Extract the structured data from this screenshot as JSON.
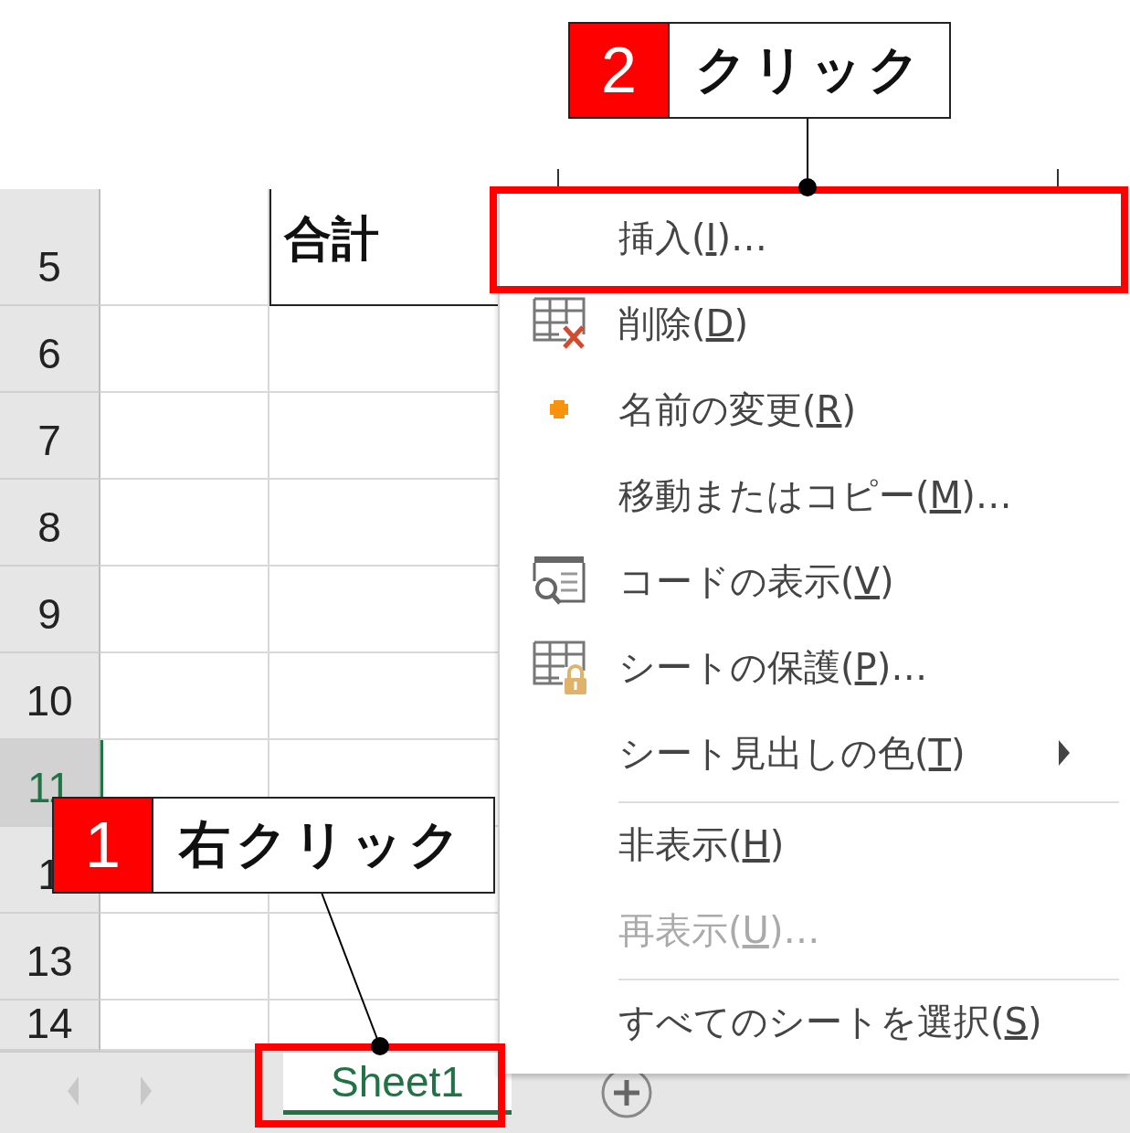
{
  "sheet": {
    "rows": [
      {
        "label": "5",
        "selected": false
      },
      {
        "label": "6",
        "selected": false
      },
      {
        "label": "7",
        "selected": false
      },
      {
        "label": "8",
        "selected": false
      },
      {
        "label": "9",
        "selected": false
      },
      {
        "label": "10",
        "selected": false
      },
      {
        "label": "11",
        "selected": true
      },
      {
        "label": "1",
        "selected": false
      },
      {
        "label": "13",
        "selected": false
      },
      {
        "label": "14",
        "selected": false
      }
    ],
    "total_cell": "合計",
    "tabs": [
      {
        "label": "Sheet1",
        "selected": true
      }
    ]
  },
  "context_menu": {
    "items": [
      {
        "before": "挿入(",
        "key": "I",
        "after": ")…",
        "kind": "plain",
        "disabled": false,
        "submenu": false,
        "separator_before": false
      },
      {
        "before": "削除(",
        "key": "D",
        "after": ")",
        "kind": "delete",
        "disabled": false,
        "submenu": false,
        "separator_before": false
      },
      {
        "before": "名前の変更(",
        "key": "R",
        "after": ")",
        "kind": "rename",
        "disabled": false,
        "submenu": false,
        "separator_before": false
      },
      {
        "before": "移動またはコピー(",
        "key": "M",
        "after": ")…",
        "kind": "plain",
        "disabled": false,
        "submenu": false,
        "separator_before": false
      },
      {
        "before": "コードの表示(",
        "key": "V",
        "after": ")",
        "kind": "code",
        "disabled": false,
        "submenu": false,
        "separator_before": false
      },
      {
        "before": "シートの保護(",
        "key": "P",
        "after": ")…",
        "kind": "protect",
        "disabled": false,
        "submenu": false,
        "separator_before": false
      },
      {
        "before": "シート見出しの色(",
        "key": "T",
        "after": ")",
        "kind": "plain",
        "disabled": false,
        "submenu": true,
        "separator_before": false
      },
      {
        "before": "非表示(",
        "key": "H",
        "after": ")",
        "kind": "plain",
        "disabled": false,
        "submenu": false,
        "separator_before": true
      },
      {
        "before": "再表示(",
        "key": "U",
        "after": ")…",
        "kind": "plain",
        "disabled": true,
        "submenu": false,
        "separator_before": false
      },
      {
        "before": "すべてのシートを選択(",
        "key": "S",
        "after": ")",
        "kind": "plain",
        "disabled": false,
        "submenu": false,
        "separator_before": true
      }
    ]
  },
  "callouts": [
    {
      "number": "2",
      "text": "クリック"
    },
    {
      "number": "1",
      "text": "右クリック"
    }
  ]
}
